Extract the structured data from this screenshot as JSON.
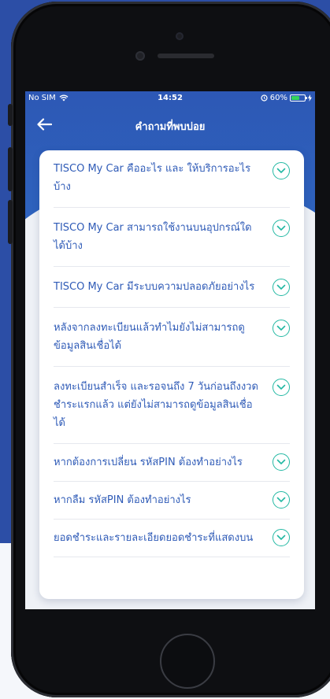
{
  "status_bar": {
    "carrier": "No SIM",
    "time": "14:52",
    "battery": "60%",
    "battery_level": 0.6
  },
  "header": {
    "title": "คำถามที่พบบ่อย"
  },
  "faq": {
    "items": [
      {
        "question": "TISCO My Car คืออะไร และ ให้บริการอะไรบ้าง"
      },
      {
        "question": "TISCO My Car สามารถใช้งานบนอุปกรณ์ใดได้บ้าง"
      },
      {
        "question": "TISCO My Car มีระบบความปลอดภัยอย่างไร"
      },
      {
        "question": "หลังจากลงทะเบียนแล้วทำไมยังไม่สามารถดูข้อมูลสินเชื่อได้"
      },
      {
        "question": "ลงทะเบียนสำเร็จ และรอจนถึง 7 วันก่อนถึงงวดชำระแรกแล้ว แต่ยังไม่สามารถดูข้อมูลสินเชื่อได้"
      },
      {
        "question": "หากต้องการเปลี่ยน รหัสPIN ต้องทำอย่างไร"
      },
      {
        "question": "หากลืม รหัสPIN ต้องทำอย่างไร"
      },
      {
        "question": "ยอดชำระและรายละเอียดยอดชำระที่แสดงบน"
      }
    ]
  },
  "colors": {
    "brand_blue": "#2e5bb7",
    "accent_teal": "#22b8a3"
  },
  "icons": {
    "back": "arrow-left-icon",
    "expand": "chevron-down-circle-icon",
    "wifi": "wifi-icon",
    "battery": "battery-icon"
  }
}
